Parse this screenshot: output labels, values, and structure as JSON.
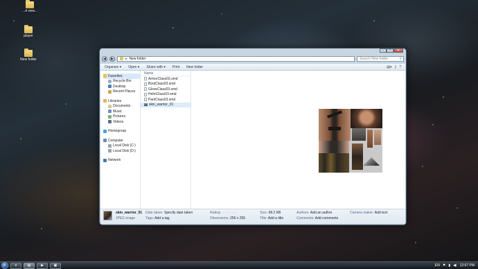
{
  "desktop": {
    "icons": [
      {
        "label": "...rt new..."
      },
      {
        "label": "player"
      },
      {
        "label": "New folder"
      }
    ]
  },
  "window": {
    "title_controls": {
      "minimize": "–",
      "maximize": "□",
      "close": "✕"
    },
    "address": "New folder",
    "search_placeholder": "Search New folder",
    "toolbar": {
      "organize": "Organize ▾",
      "open": "Open ▾",
      "share_with": "Share with ▾",
      "print": "Print",
      "new_folder": "New folder"
    },
    "nav": {
      "favorites": {
        "label": "Favorites",
        "items": [
          "Recycle Bin",
          "Desktop",
          "Recent Places"
        ]
      },
      "libraries": {
        "label": "Libraries",
        "items": [
          "Documents",
          "Music",
          "Pictures",
          "Videos"
        ]
      },
      "homegroup": "Homegroup",
      "computer": {
        "label": "Computer",
        "items": [
          "Local Disk (C:)",
          "Local Disk (D:)"
        ]
      },
      "network": "Network"
    },
    "file_list": {
      "column": "Name",
      "files": [
        {
          "name": "ArmorClass03.smd",
          "type": "doc"
        },
        {
          "name": "BootClass03.smd",
          "type": "doc"
        },
        {
          "name": "GloveClass03.smd",
          "type": "doc"
        },
        {
          "name": "HelmClass03.smd",
          "type": "doc"
        },
        {
          "name": "PantClass03.smd",
          "type": "doc"
        },
        {
          "name": "skin_warrior_01",
          "type": "image"
        }
      ]
    },
    "details": {
      "filename": "skin_warrior_01",
      "filetype": "JPEG image",
      "date_taken_label": "Date taken:",
      "date_taken_value": "Specify date taken",
      "tags_label": "Tags:",
      "tags_value": "Add a tag",
      "rating_label": "Rating:",
      "rating_stars": "☆☆☆☆☆",
      "dimensions_label": "Dimensions:",
      "dimensions_value": "256 x 256",
      "size_label": "Size:",
      "size_value": "68.2 KB",
      "title_label": "Title:",
      "title_value": "Add a title",
      "authors_label": "Authors:",
      "authors_value": "Add an author",
      "comments_label": "Comments:",
      "comments_value": "Add comments",
      "camera_label": "Camera maker:",
      "camera_value": "Add text"
    }
  },
  "taskbar": {
    "buttons": [
      "e",
      "▤",
      "▶",
      "▣"
    ],
    "tray": {
      "lang": "EN",
      "time": "12:07 PM"
    }
  }
}
